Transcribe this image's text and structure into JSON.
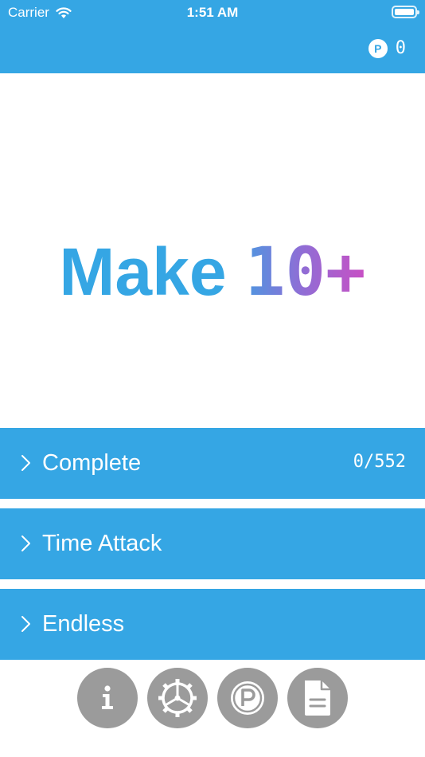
{
  "status_bar": {
    "carrier": "Carrier",
    "time": "1:51 AM"
  },
  "header": {
    "points_icon_letter": "P",
    "points": "0"
  },
  "title": {
    "word": "Make",
    "number": "10+"
  },
  "menu": [
    {
      "label": "Complete",
      "progress": "0/552"
    },
    {
      "label": "Time Attack",
      "progress": ""
    },
    {
      "label": "Endless",
      "progress": ""
    }
  ],
  "bottom_buttons": [
    {
      "icon": "info-icon"
    },
    {
      "icon": "settings-gear-icon"
    },
    {
      "icon": "points-icon"
    },
    {
      "icon": "document-icon"
    }
  ],
  "colors": {
    "primary": "#35a6e4",
    "button_gray": "#9b9b9b",
    "gradient_mid": "#8d6fd6",
    "gradient_end": "#c94fc4"
  }
}
